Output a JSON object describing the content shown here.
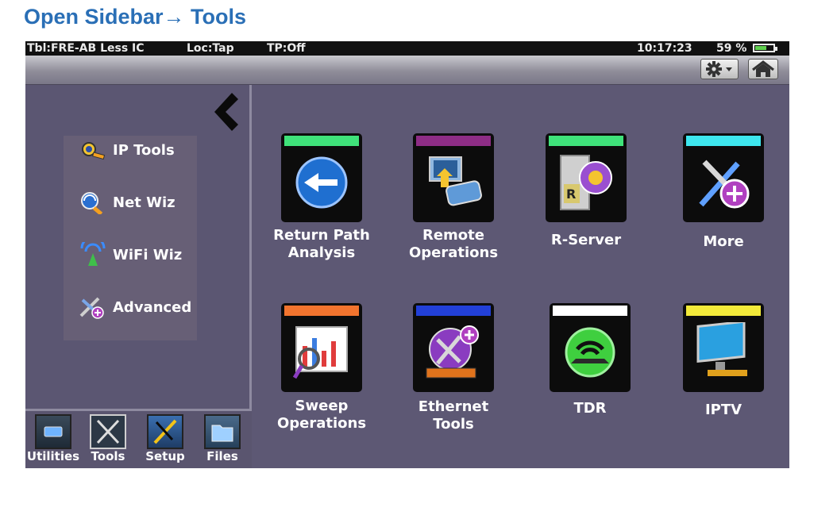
{
  "doc": {
    "title": "Open Sidebar→ Tools"
  },
  "status": {
    "table": "Tbl:FRE-AB Less IC",
    "location": "Loc:Tap",
    "tp": "TP:Off",
    "time": "10:17:23",
    "battery": "59 %",
    "battery_level": 0.59
  },
  "toolbar": {
    "settings_icon": "gear-icon",
    "home_icon": "home-icon"
  },
  "sidebar": {
    "collapse_icon": "chevron-left-icon",
    "items": [
      {
        "label": "IP Tools",
        "icon": "ip-tools-icon"
      },
      {
        "label": "Net Wiz",
        "icon": "net-wiz-icon"
      },
      {
        "label": "WiFi Wiz",
        "icon": "wifi-wiz-icon"
      },
      {
        "label": "Advanced",
        "icon": "advanced-icon"
      }
    ]
  },
  "dock": [
    {
      "label": "Utilities",
      "icon": "utilities-icon"
    },
    {
      "label": "Tools",
      "icon": "tools-icon"
    },
    {
      "label": "Setup",
      "icon": "setup-icon"
    },
    {
      "label": "Files",
      "icon": "files-icon"
    }
  ],
  "apps": [
    {
      "label": "Return Path\nAnalysis",
      "color": "#3fe27a",
      "icon": "return-path-icon"
    },
    {
      "label": "Remote\nOperations",
      "color": "#8e2d86",
      "icon": "remote-operations-icon"
    },
    {
      "label": "R-Server",
      "color": "#3fe27a",
      "icon": "r-server-icon"
    },
    {
      "label": "More",
      "color": "#3ee6ee",
      "icon": "more-icon"
    },
    {
      "label": "Sweep\nOperations",
      "color": "#f2742e",
      "icon": "sweep-icon"
    },
    {
      "label": "Ethernet\nTools",
      "color": "#2240d8",
      "icon": "ethernet-icon"
    },
    {
      "label": "TDR",
      "color": "#ffffff",
      "icon": "tdr-icon"
    },
    {
      "label": "IPTV",
      "color": "#f3ea3a",
      "icon": "iptv-icon"
    }
  ]
}
